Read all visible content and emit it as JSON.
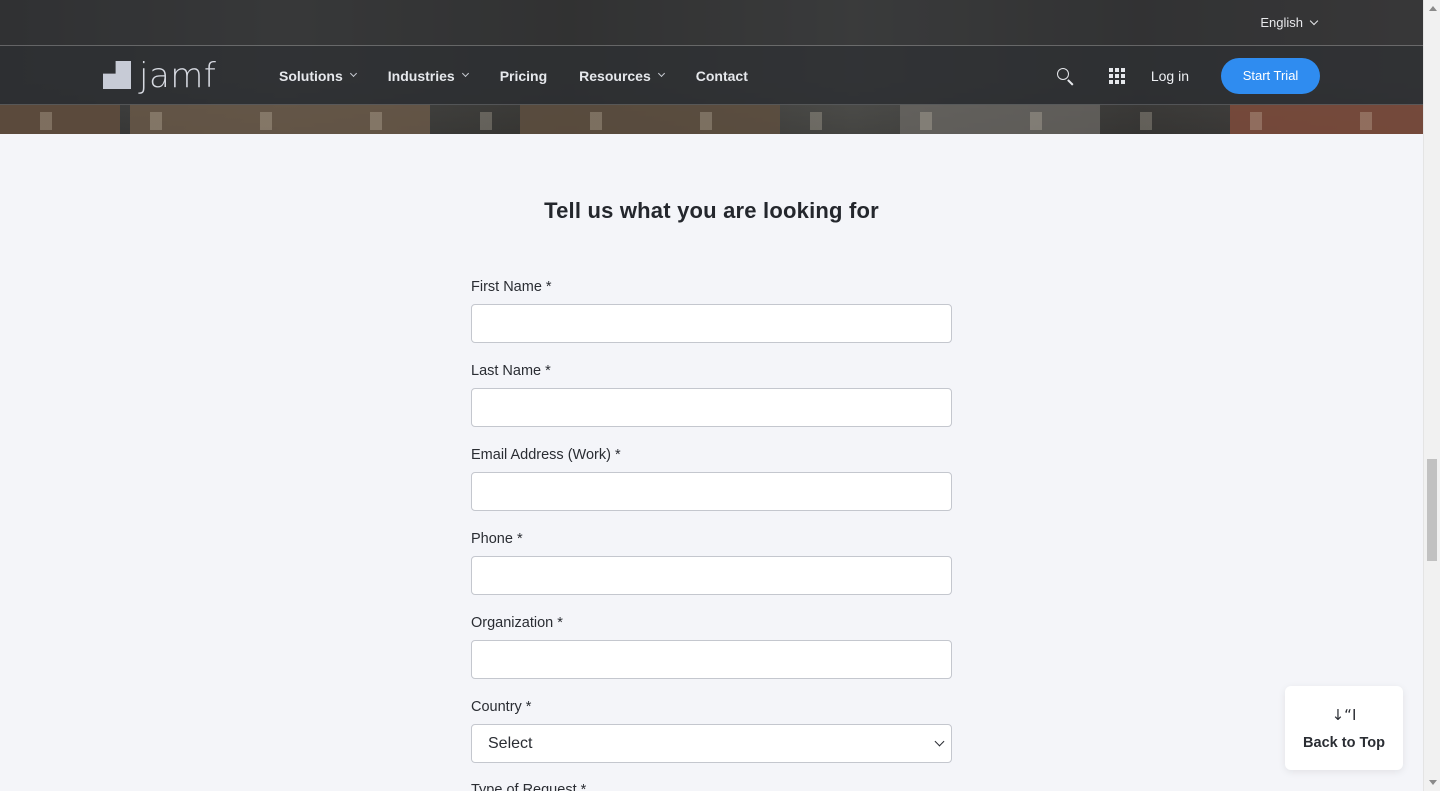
{
  "topbar": {
    "language": "English"
  },
  "nav": {
    "logo_text": "jamf",
    "items": [
      {
        "label": "Solutions",
        "has_dropdown": true
      },
      {
        "label": "Industries",
        "has_dropdown": true
      },
      {
        "label": "Pricing",
        "has_dropdown": false
      },
      {
        "label": "Resources",
        "has_dropdown": true
      },
      {
        "label": "Contact",
        "has_dropdown": false
      }
    ],
    "search_icon": "search-icon",
    "apps_icon": "grid-icon",
    "login_label": "Log in",
    "cta_label": "Start Trial",
    "cta_color": "#2f8cf0"
  },
  "form": {
    "heading": "Tell us what you are looking for",
    "fields": [
      {
        "label": "First Name *",
        "value": ""
      },
      {
        "label": "Last Name *",
        "value": ""
      },
      {
        "label": "Email Address (Work) *",
        "value": ""
      },
      {
        "label": "Phone *",
        "value": ""
      },
      {
        "label": "Organization *",
        "value": ""
      }
    ],
    "country": {
      "label": "Country *",
      "selected": "Select"
    },
    "next_label_cutoff": "Type of Request *"
  },
  "back_to_top": {
    "glyph": "↓“I",
    "label": "Back to Top"
  }
}
